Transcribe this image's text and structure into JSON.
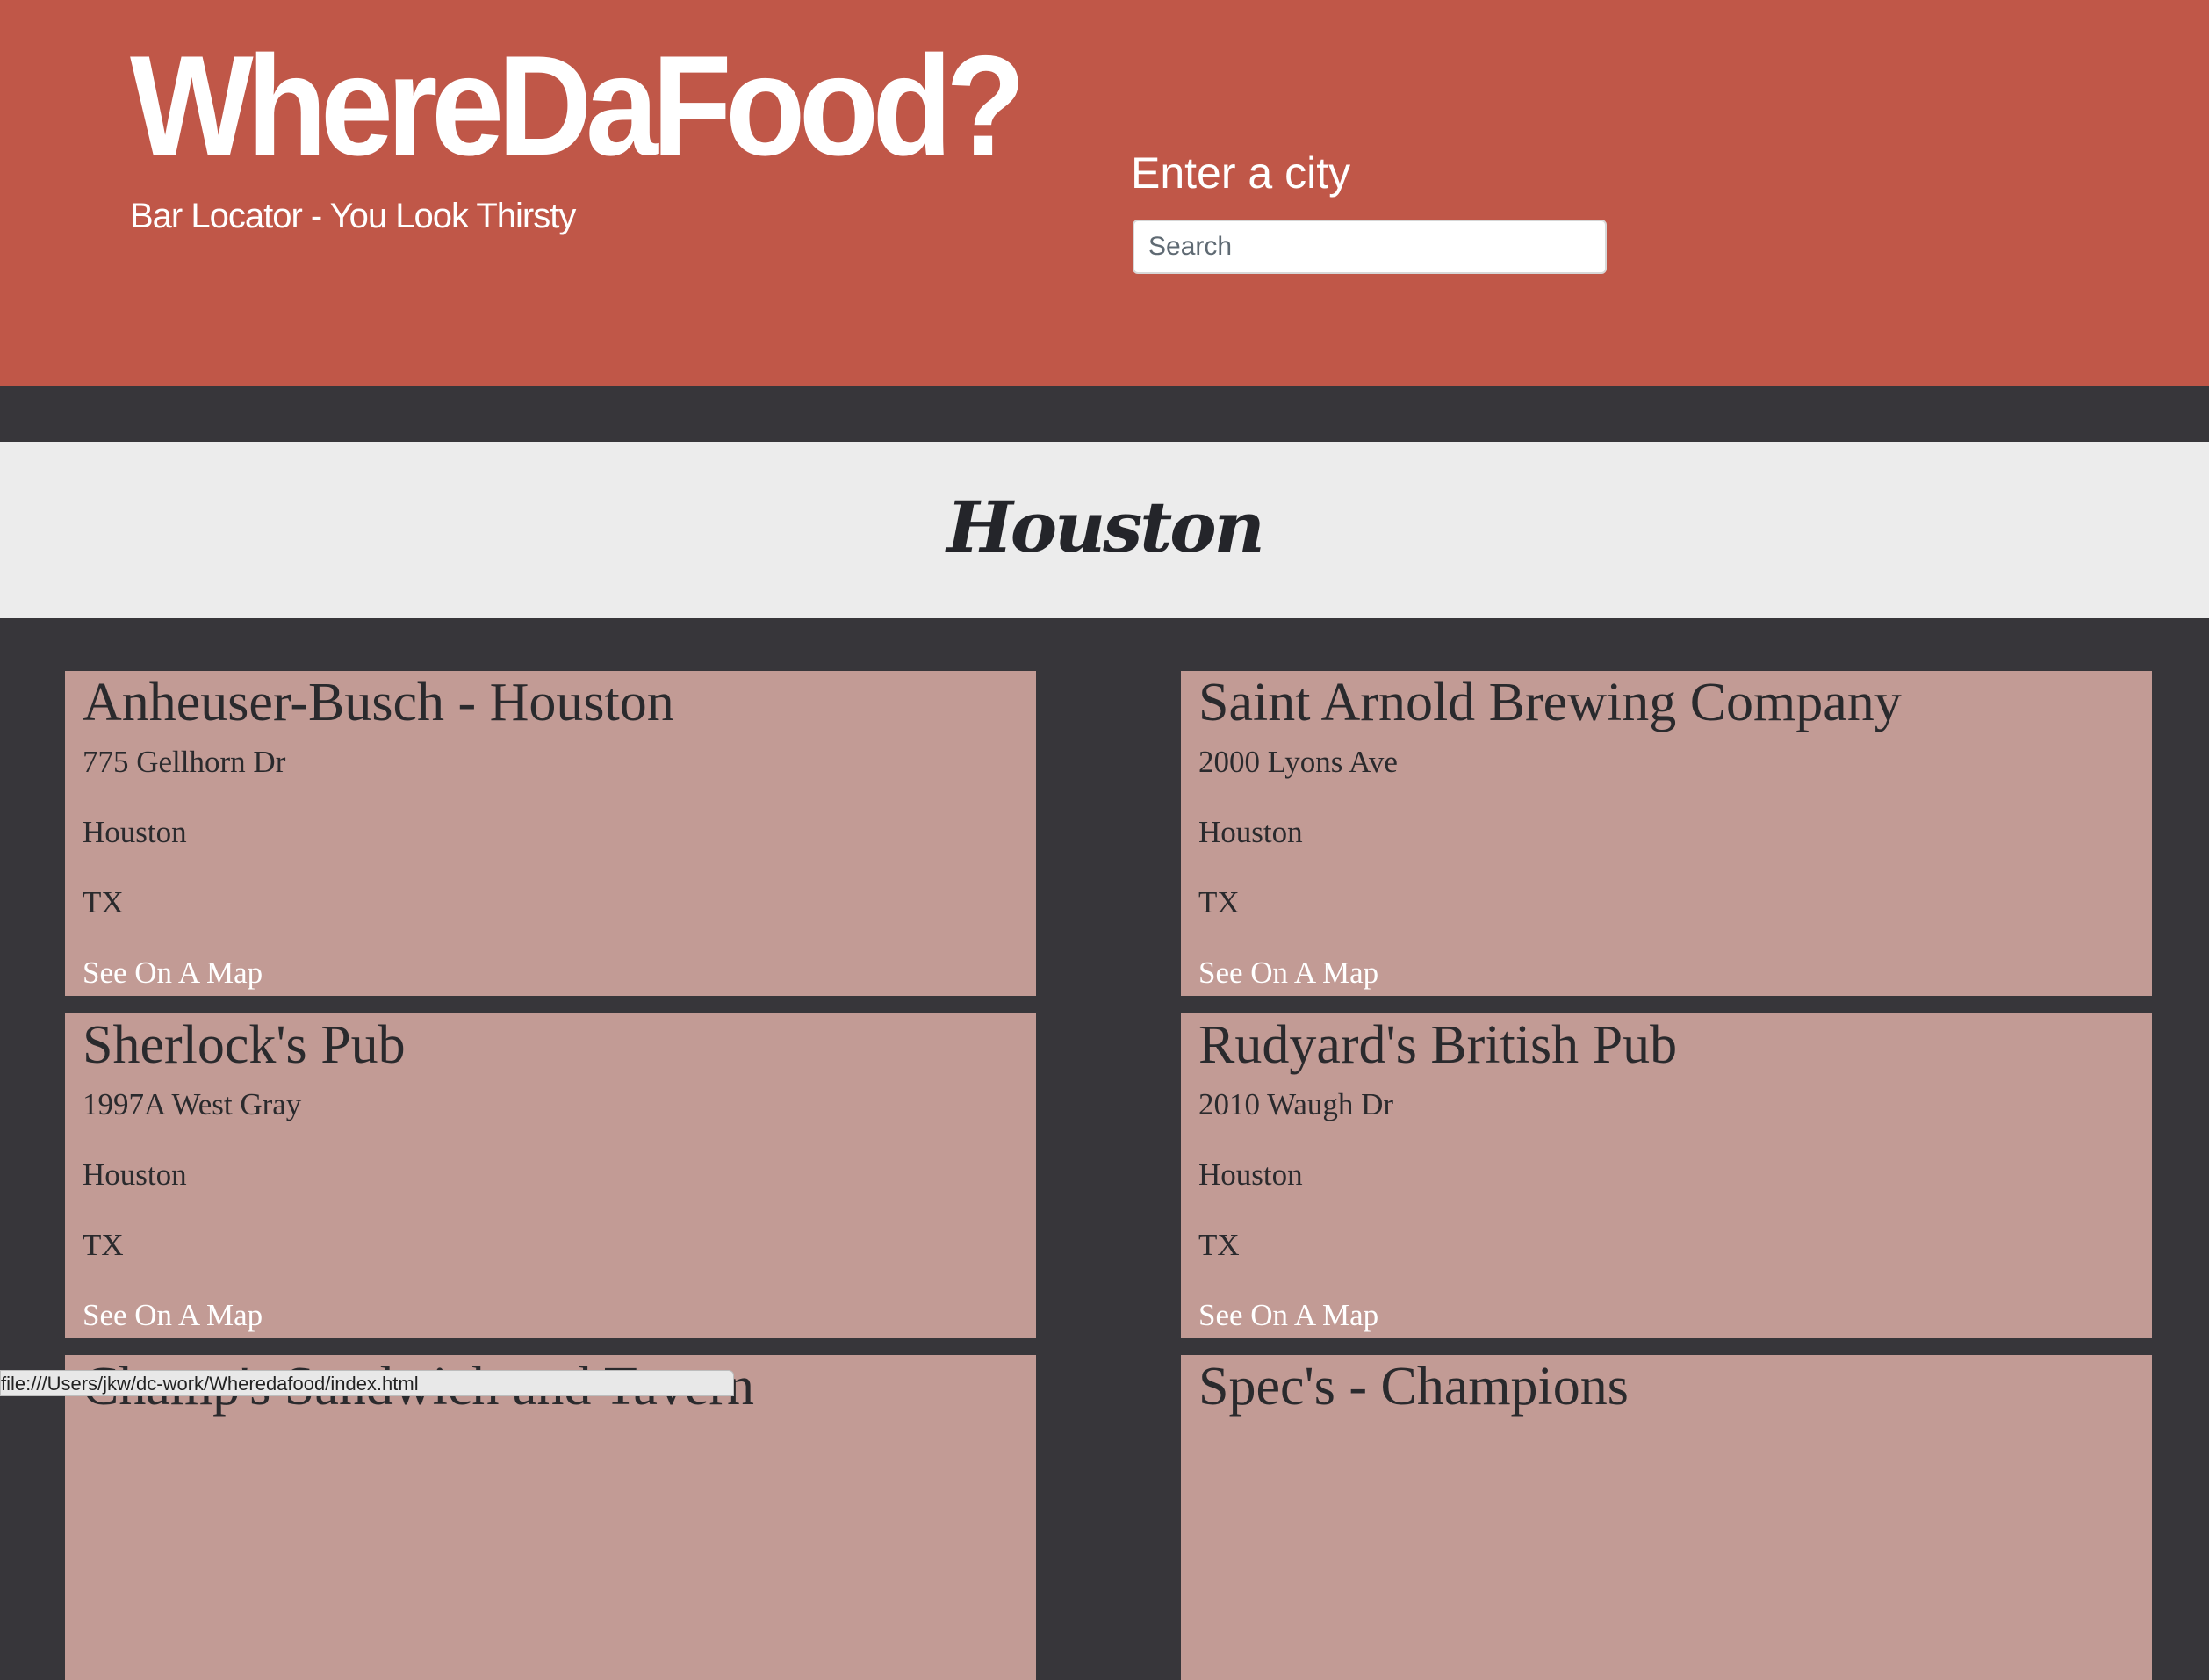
{
  "header": {
    "logo": "WhereDaFood?",
    "tagline": "Bar Locator - You Look Thirsty",
    "city_label": "Enter a city",
    "search_placeholder": "Search",
    "search_value": ""
  },
  "city_banner": {
    "title": "Houston"
  },
  "bars": [
    {
      "name": "Anheuser-Busch - Houston",
      "street": "775 Gellhorn Dr",
      "city": "Houston",
      "state": "TX",
      "map_link": "See On A Map"
    },
    {
      "name": "Saint Arnold Brewing Company",
      "street": "2000 Lyons Ave",
      "city": "Houston",
      "state": "TX",
      "map_link": "See On A Map"
    },
    {
      "name": "Sherlock's Pub",
      "street": "1997A West Gray",
      "city": "Houston",
      "state": "TX",
      "map_link": "See On A Map"
    },
    {
      "name": "Rudyard's British Pub",
      "street": "2010 Waugh Dr",
      "city": "Houston",
      "state": "TX",
      "map_link": "See On A Map"
    },
    {
      "name": "Champ's Sandwich and Tavern",
      "street": "",
      "city": "",
      "state": "",
      "map_link": ""
    },
    {
      "name": "Spec's - Champions",
      "street": "",
      "city": "",
      "state": "",
      "map_link": ""
    }
  ],
  "status_bar": {
    "url": "file:///Users/jkw/dc-work/Wheredafood/index.html"
  },
  "colors": {
    "header_bg": "#c05748",
    "page_bg": "#37363a",
    "banner_bg": "#ececec",
    "card_bg": "#c29b95"
  }
}
